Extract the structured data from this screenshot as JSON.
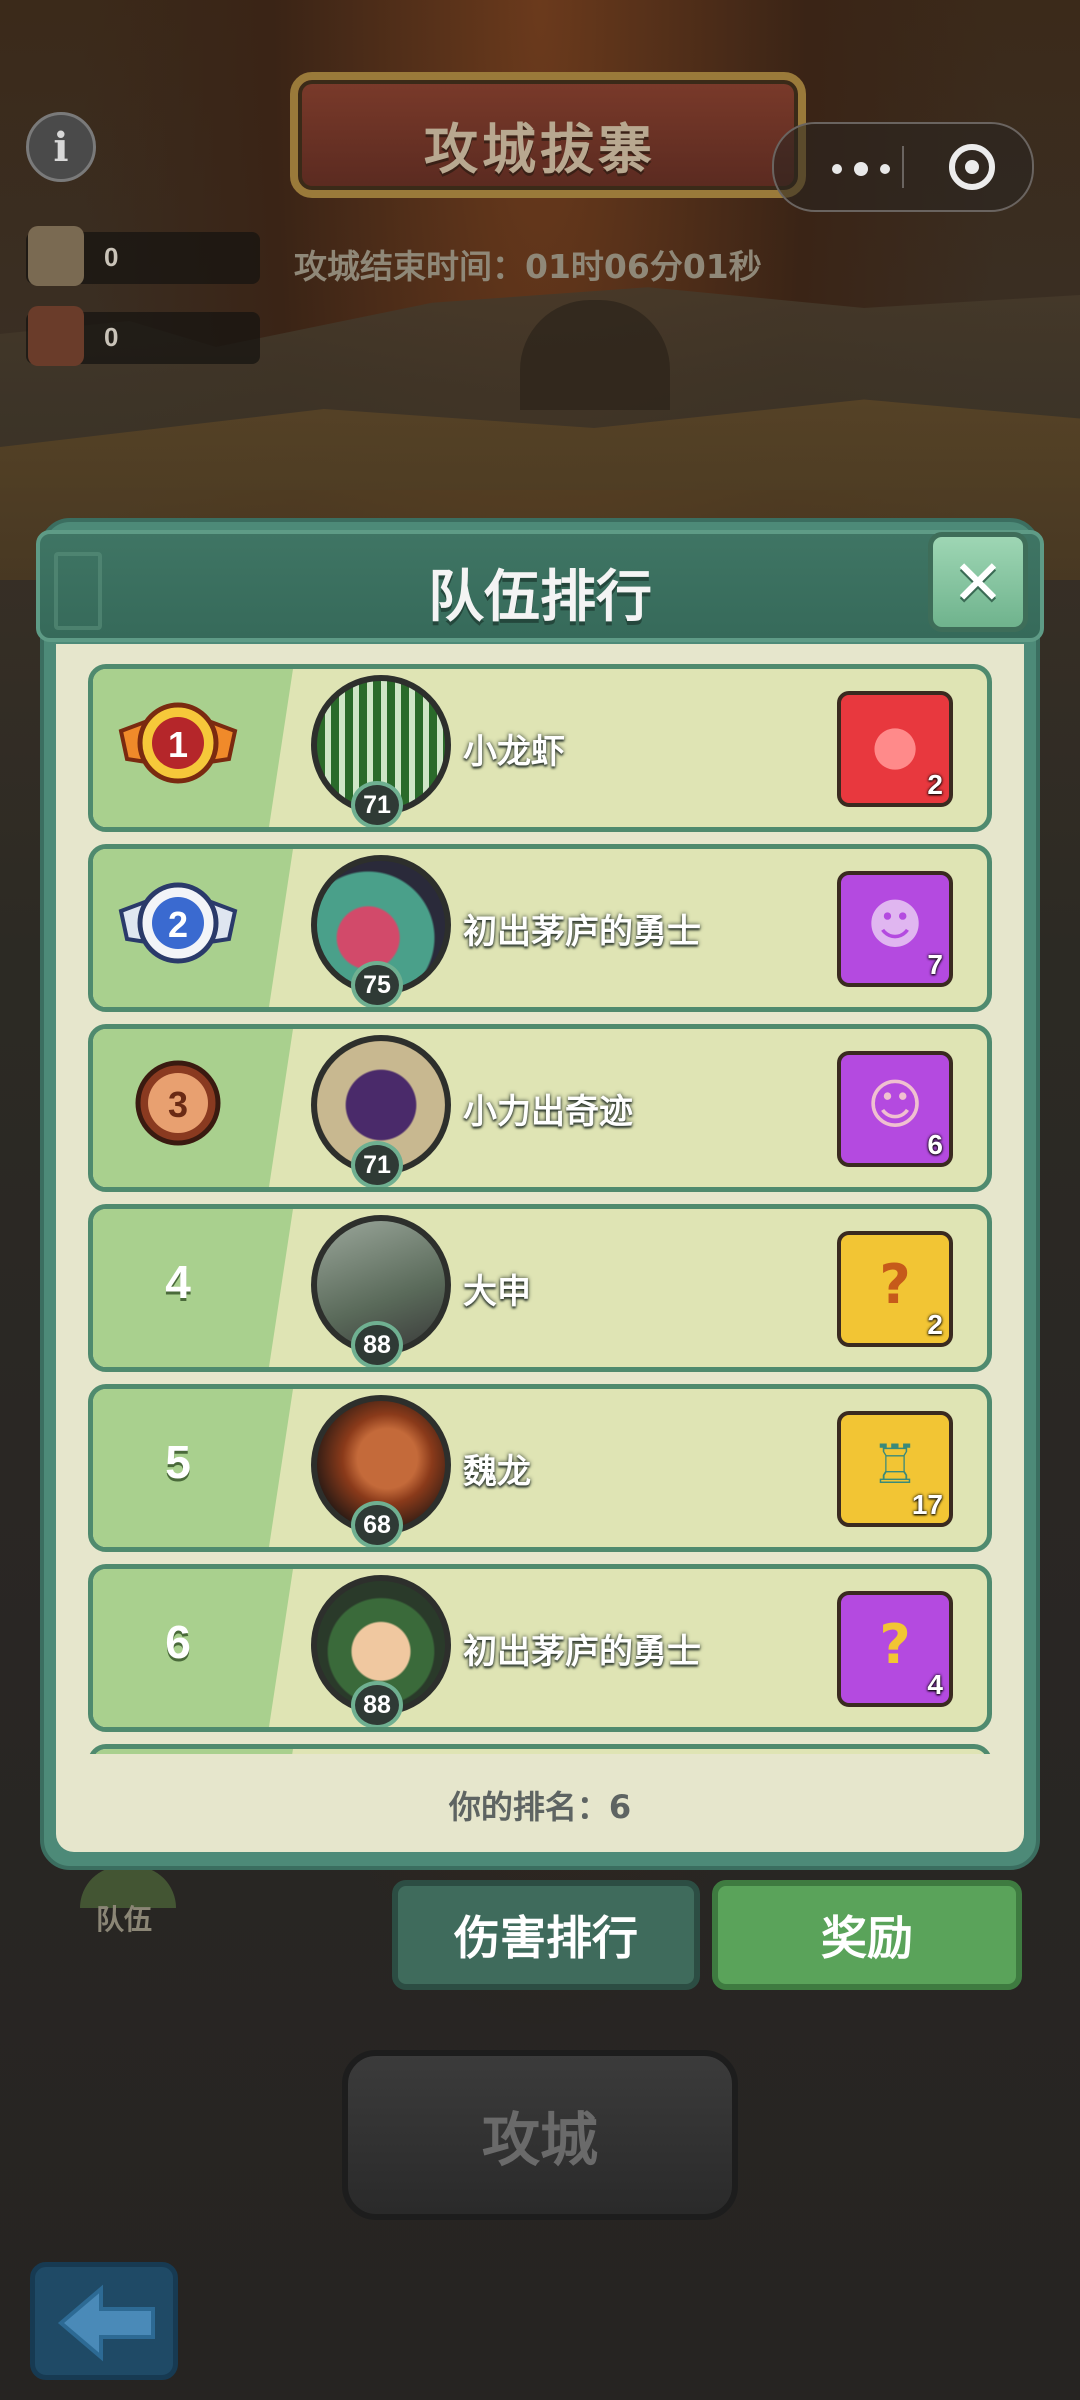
{
  "hud": {
    "info_icon": "info-icon",
    "banner_title": "攻城拔寨",
    "countdown": "攻城结束时间：01时06分01秒",
    "resources": [
      {
        "icon": "supply-crate-icon",
        "value": "0"
      },
      {
        "icon": "scroll-map-icon",
        "value": "0"
      }
    ]
  },
  "dialog": {
    "title": "队伍排行",
    "close_icon": "close-icon",
    "your_rank": "你的排名：6",
    "rows": [
      {
        "rank": "1",
        "medal": "gold",
        "level": "71",
        "name": "小龙虾",
        "reward_type": "red-egg",
        "reward_count": "2",
        "reward_color": "#e8383e"
      },
      {
        "rank": "2",
        "medal": "silver",
        "level": "75",
        "name": "初出茅庐的勇士",
        "reward_type": "purple-hero-card",
        "reward_count": "7",
        "reward_color": "#b44ae0"
      },
      {
        "rank": "3",
        "medal": "bronze",
        "level": "71",
        "name": "小力出奇迹",
        "reward_type": "purple-hero-card",
        "reward_count": "6",
        "reward_color": "#b44ae0"
      },
      {
        "rank": "4",
        "medal": "none",
        "level": "88",
        "name": "大申",
        "reward_type": "gold-puzzle",
        "reward_count": "2",
        "reward_color": "#f2c534"
      },
      {
        "rank": "5",
        "medal": "none",
        "level": "68",
        "name": "魏龙",
        "reward_type": "bronze-vessel",
        "reward_count": "17",
        "reward_color": "#f2c534"
      },
      {
        "rank": "6",
        "medal": "none",
        "level": "88",
        "name": "初出茅庐的勇士",
        "reward_type": "purple-puzzle",
        "reward_count": "4",
        "reward_color": "#b44ae0"
      }
    ]
  },
  "bottom": {
    "team_label": "队伍",
    "damage_tab": "伤害排行",
    "reward_tab": "奖励",
    "siege_button": "攻城",
    "back_icon": "back-arrow-icon"
  }
}
